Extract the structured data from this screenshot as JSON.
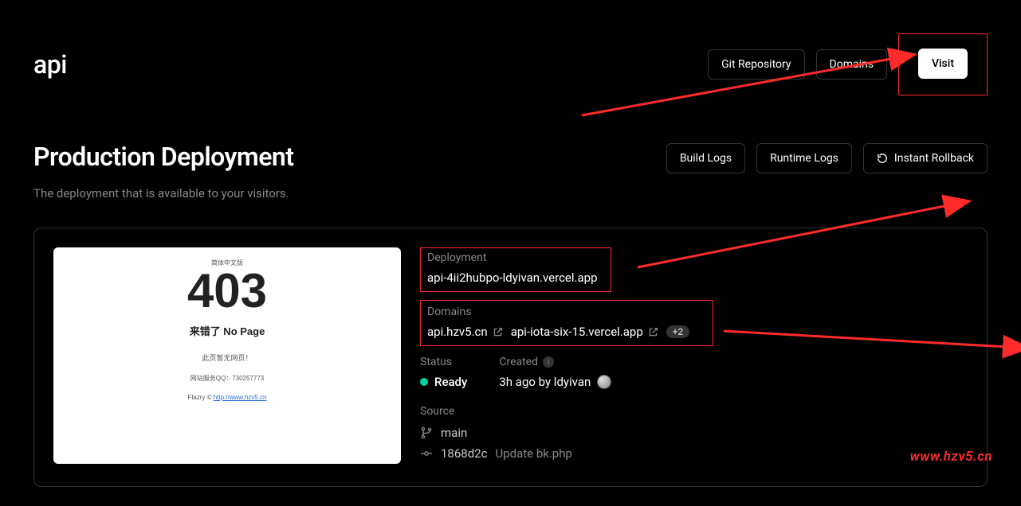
{
  "header": {
    "title": "api",
    "git_repo_label": "Git Repository",
    "domains_label": "Domains",
    "visit_label": "Visit"
  },
  "section": {
    "title": "Production Deployment",
    "subtitle": "The deployment that is available to your visitors.",
    "build_logs_label": "Build Logs",
    "runtime_logs_label": "Runtime Logs",
    "instant_rollback_label": "Instant Rollback"
  },
  "preview": {
    "top_text": "简体中文版",
    "code": "403",
    "no_page": "来错了 No Page",
    "line1": "此页暂无网页！",
    "line2": "网站服务QQ：730257773",
    "footer_prefix": "Flazry © ",
    "footer_link": "http://www.hzv5.cn"
  },
  "deployment": {
    "label": "Deployment",
    "value": "api-4ii2hubpo-ldyivan.vercel.app"
  },
  "domains": {
    "label": "Domains",
    "items": [
      "api.hzv5.cn",
      "api-iota-six-15.vercel.app"
    ],
    "extra_badge": "+2"
  },
  "status": {
    "label": "Status",
    "value": "Ready"
  },
  "created": {
    "label": "Created",
    "value": "3h ago by ldyivan"
  },
  "source": {
    "label": "Source",
    "branch": "main",
    "commit_hash": "1868d2c",
    "commit_msg": "Update bk.php"
  },
  "watermark": "www.hzv5.cn",
  "colors": {
    "highlight": "#ff2b2b",
    "ready": "#00d4a0"
  }
}
